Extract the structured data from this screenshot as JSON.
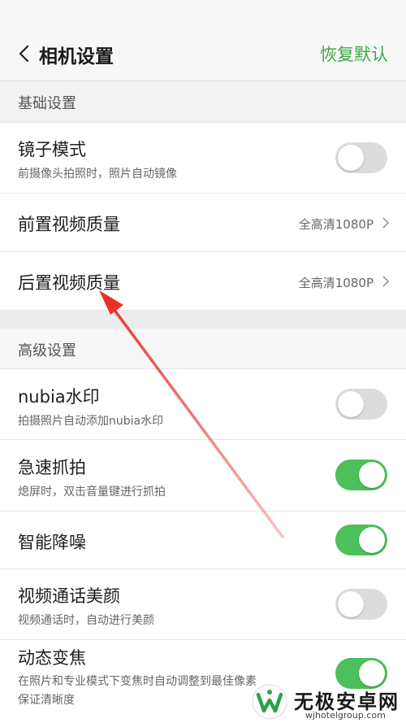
{
  "header": {
    "title": "相机设置",
    "restore_label": "恢复默认"
  },
  "sections": {
    "basic": "基础设置",
    "advanced": "高级设置"
  },
  "rows": {
    "mirror": {
      "title": "镜子模式",
      "sub": "前摄像头拍照时，照片自动镜像",
      "toggle": "off"
    },
    "front_video": {
      "title": "前置视频质量",
      "value": "全高清1080P"
    },
    "rear_video": {
      "title": "后置视频质量",
      "value": "全高清1080P"
    },
    "watermark": {
      "title": "nubia水印",
      "sub": "拍摄照片自动添加nubia水印",
      "toggle": "off"
    },
    "snap": {
      "title": "急速抓拍",
      "sub": "熄屏时，双击音量键进行抓拍",
      "toggle": "on"
    },
    "denoise": {
      "title": "智能降噪",
      "toggle": "on"
    },
    "beauty": {
      "title": "视频通话美颜",
      "sub": "视频通话时，自动进行美颜",
      "toggle": "off"
    },
    "zoom": {
      "title": "动态变焦",
      "sub1": "在照片和专业模式下变焦时自动调整到最佳像素",
      "sub2": "保证清晰度",
      "toggle": "on"
    }
  },
  "site_watermark": {
    "name": "无极安卓网",
    "url": "wjhotelgroup.com"
  },
  "colors": {
    "accent_green": "#3fa846",
    "toggle_on": "#4cc05a",
    "toggle_off": "#dcdcdc",
    "annotation_arrow": "#e8322b"
  }
}
